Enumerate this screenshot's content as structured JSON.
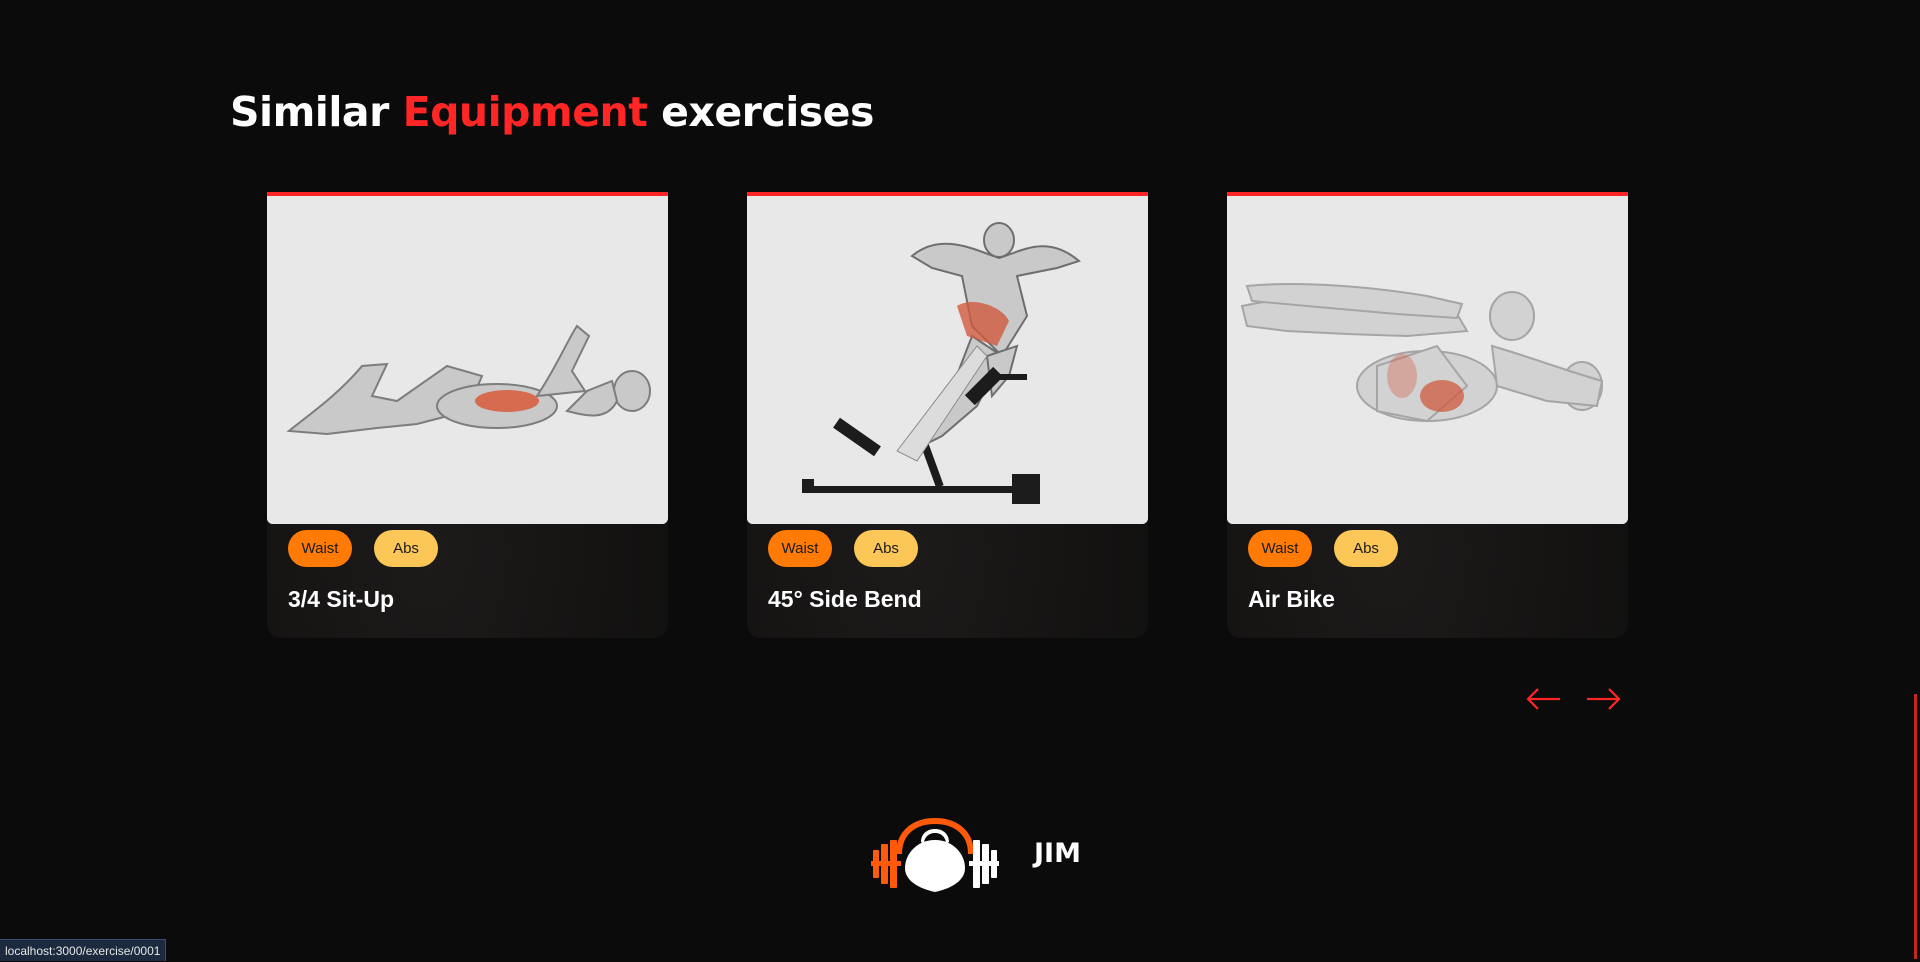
{
  "section": {
    "title_prefix": "Similar ",
    "title_accent": "Equipment",
    "title_suffix": " exercises"
  },
  "cards": [
    {
      "body_part": "Waist",
      "target": "Abs",
      "name": "3/4 Sit-Up"
    },
    {
      "body_part": "Waist",
      "target": "Abs",
      "name": "45° Side Bend"
    },
    {
      "body_part": "Waist",
      "target": "Abs",
      "name": "Air Bike"
    }
  ],
  "pagination": {
    "prev_icon": "arrow-left-icon",
    "next_icon": "arrow-right-icon"
  },
  "footer": {
    "brand": "JIM",
    "logo_icon": "kettlebell-dumbbell-logo"
  },
  "status_bar": {
    "url": "localhost:3000/exercise/0001"
  },
  "colors": {
    "background": "#0c0b0b",
    "accent": "#ff2625",
    "body_part_pill": "#ff7b05",
    "target_pill": "#fcc757",
    "card_image_bg": "#e8e8e8"
  }
}
